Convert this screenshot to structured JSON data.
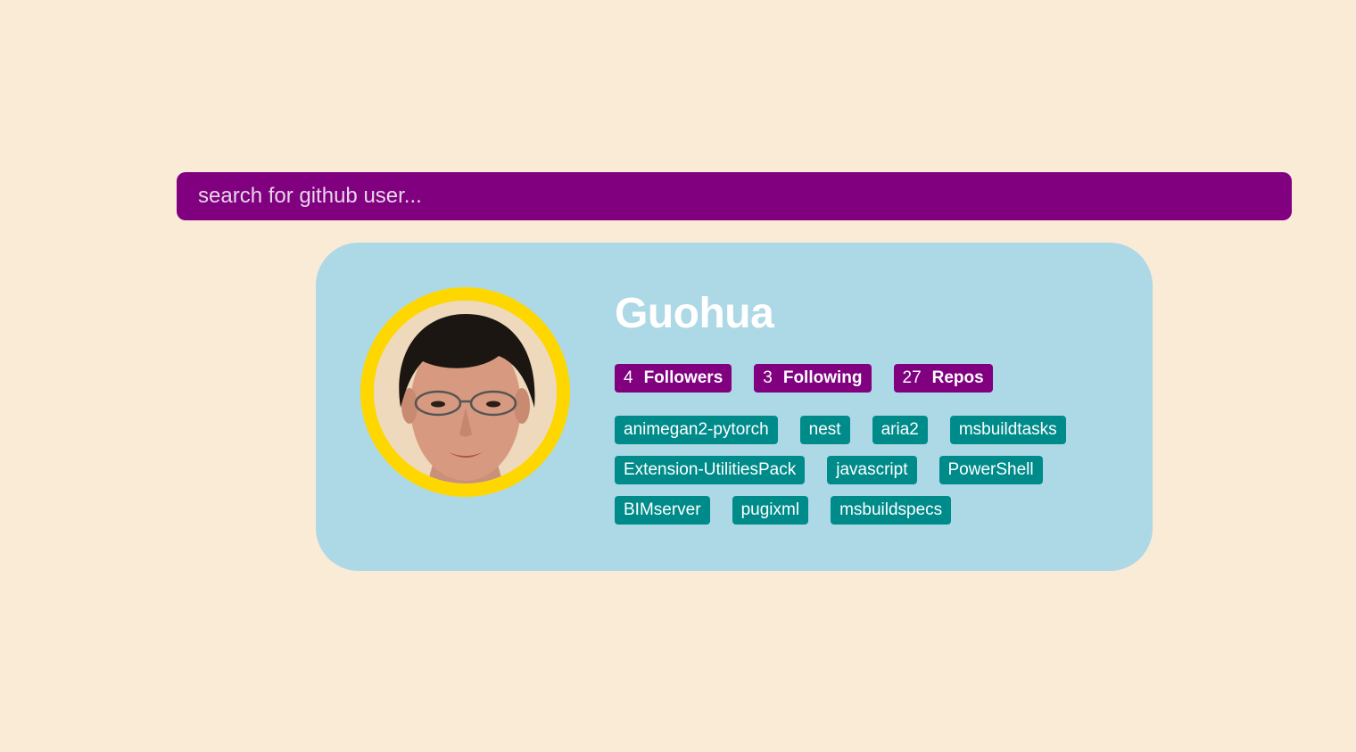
{
  "search": {
    "placeholder": "search for github user..."
  },
  "profile": {
    "name": "Guohua",
    "avatar_alt": "Guohua avatar",
    "stats": [
      {
        "value": "4",
        "label": "Followers"
      },
      {
        "value": "3",
        "label": "Following"
      },
      {
        "value": "27",
        "label": "Repos"
      }
    ],
    "repos": [
      "animegan2-pytorch",
      "nest",
      "aria2",
      "msbuildtasks",
      "Extension-UtilitiesPack",
      "javascript",
      "PowerShell",
      "BIMserver",
      "pugixml",
      "msbuildspecs"
    ]
  },
  "colors": {
    "background": "#faebd7",
    "search_bg": "#800080",
    "card_bg": "#add8e6",
    "avatar_ring": "#ffd700",
    "stat_bg": "#800080",
    "repo_bg": "#008b8b",
    "text": "#ffffff"
  }
}
